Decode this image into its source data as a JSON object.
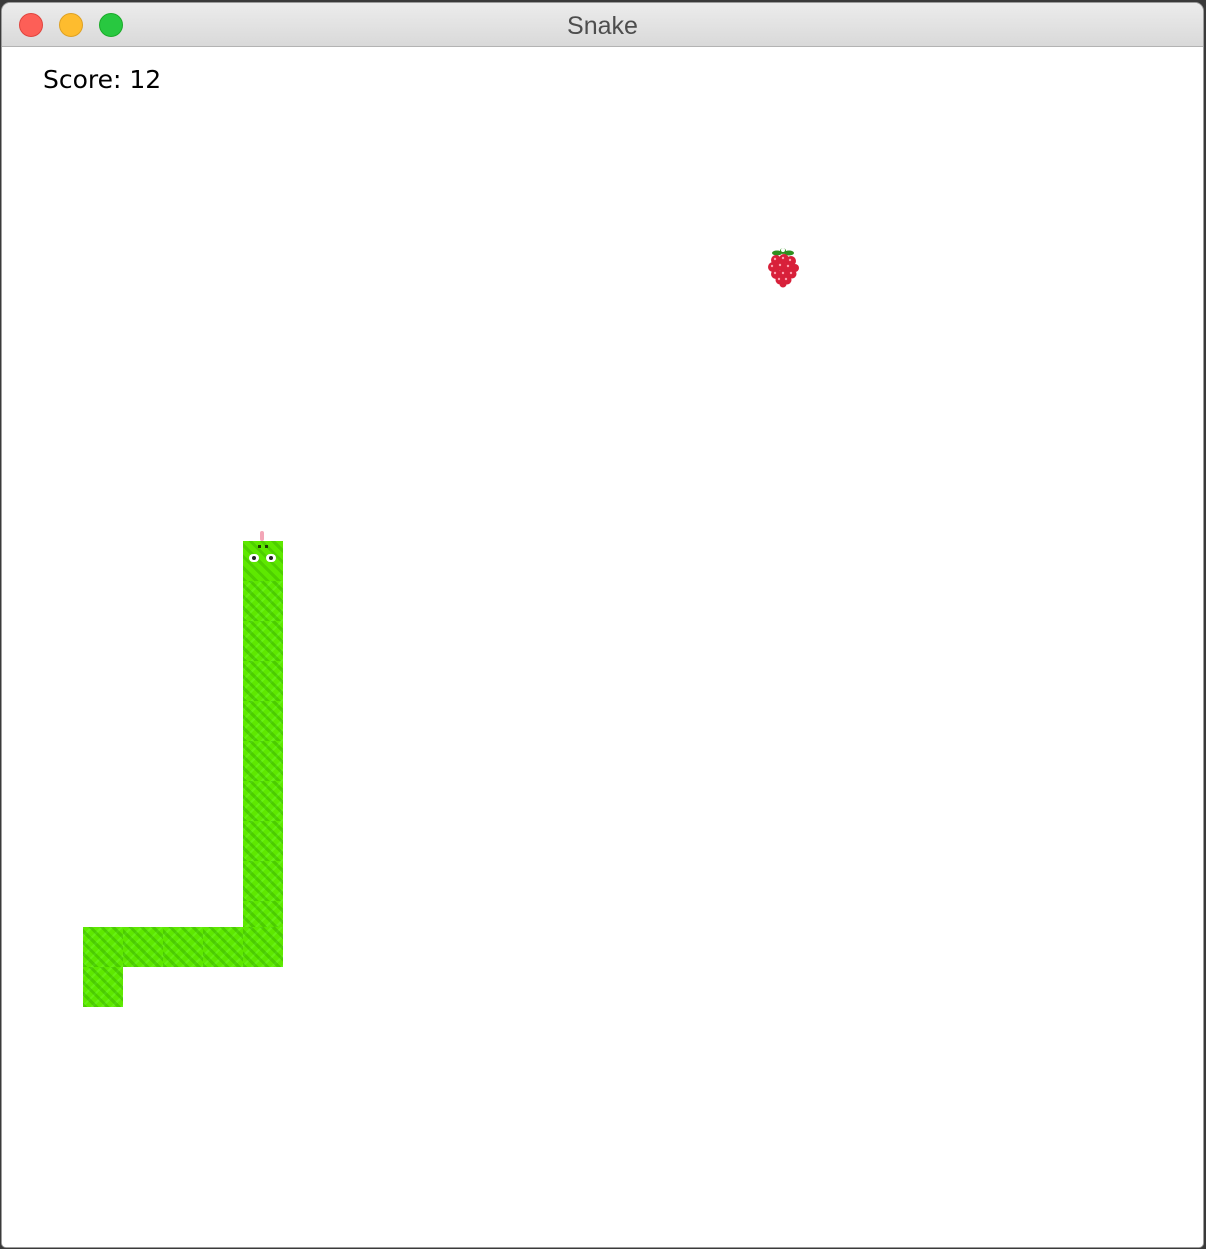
{
  "window": {
    "title": "Snake"
  },
  "game": {
    "score_text": "Score: 12",
    "grid_cell_size": 40,
    "snake_direction": "up",
    "snake_length": 16,
    "colors": {
      "snake": "#5ee800",
      "fruit": "#d8203a",
      "background": "#ffffff"
    },
    "fruit_icon": "raspberry-icon"
  }
}
